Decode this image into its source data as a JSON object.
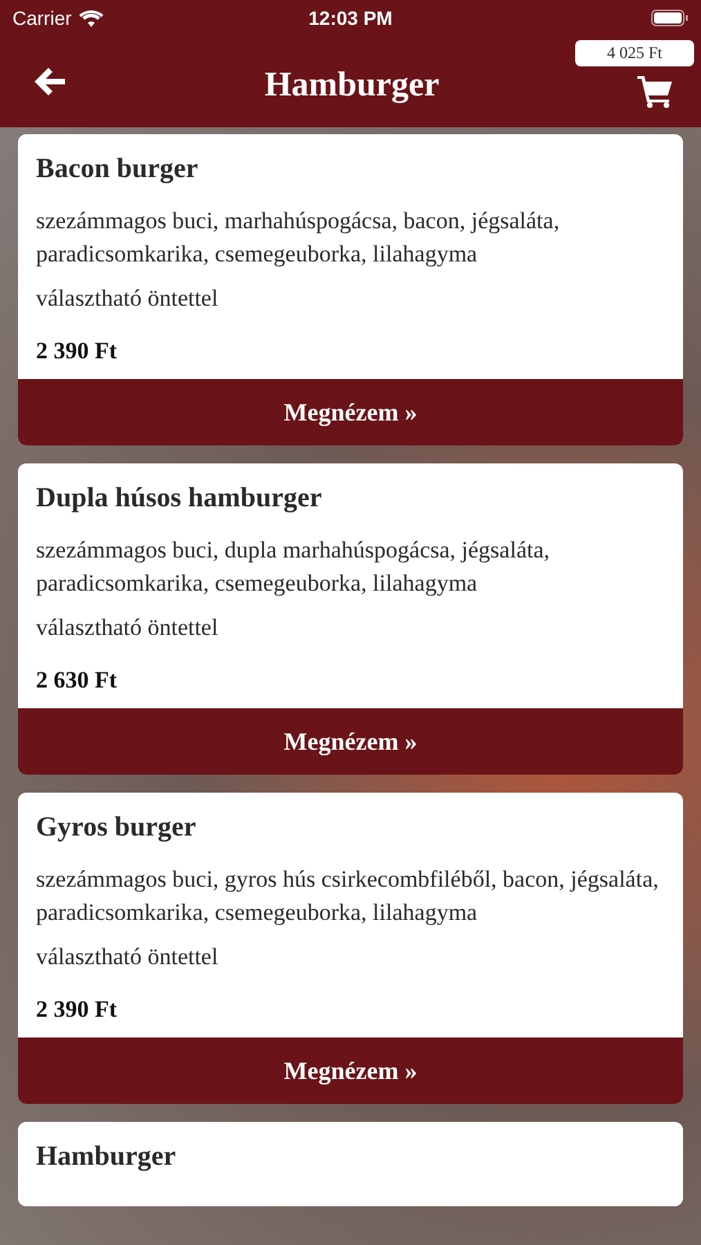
{
  "status_bar": {
    "carrier": "Carrier",
    "time": "12:03 PM"
  },
  "header": {
    "title": "Hamburger",
    "cart_total": "4 025 Ft"
  },
  "products": [
    {
      "name": "Bacon burger",
      "description": "szezámmagos buci, marhahúspogácsa, bacon, jégsaláta, paradicsomkarika, csemegeuborka, lilahagyma",
      "note": "választható öntettel",
      "price": "2 390 Ft",
      "button": "Megnézem »"
    },
    {
      "name": "Dupla húsos hamburger",
      "description": "szezámmagos buci, dupla marhahúspogácsa, jégsaláta, paradicsomkarika, csemegeuborka, lilahagyma",
      "note": "választható öntettel",
      "price": "2 630 Ft",
      "button": "Megnézem »"
    },
    {
      "name": "Gyros burger",
      "description": "szezámmagos buci, gyros hús csirkecombfiléből, bacon, jégsaláta, paradicsomkarika, csemegeuborka, lilahagyma",
      "note": "választható öntettel",
      "price": "2 390 Ft",
      "button": "Megnézem »"
    },
    {
      "name": "Hamburger"
    }
  ]
}
